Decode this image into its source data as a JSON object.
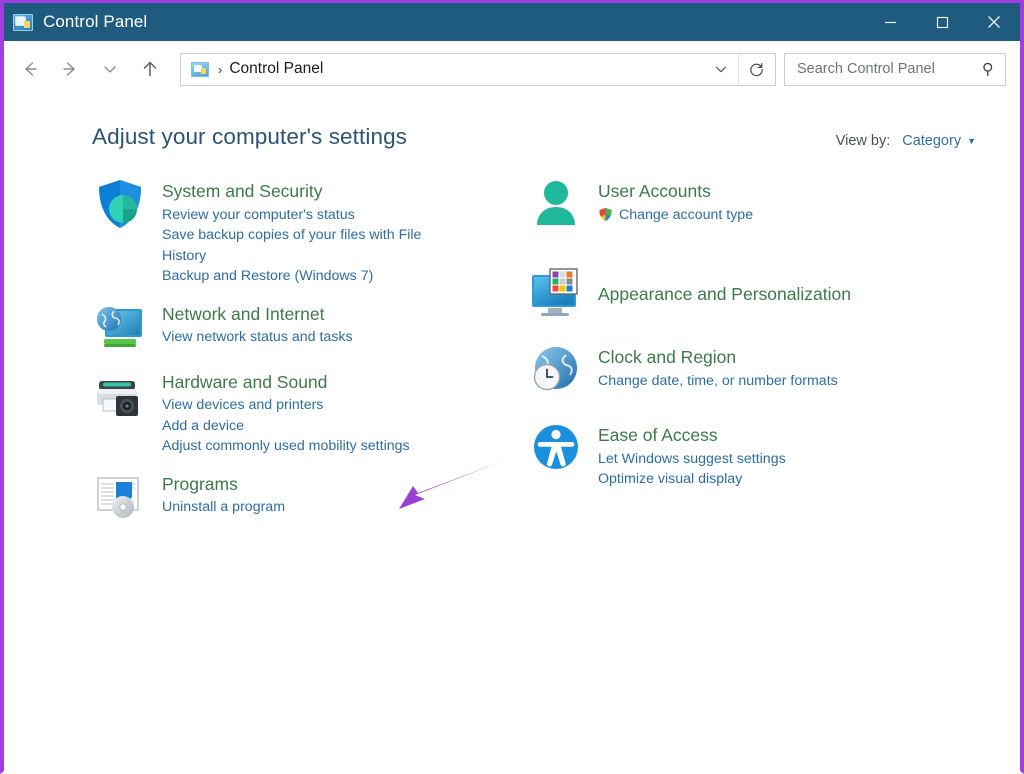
{
  "window": {
    "title": "Control Panel",
    "icon": "control-panel-icon",
    "controls": {
      "minimize": "Minimize",
      "maximize": "Maximize",
      "close": "Close"
    },
    "border_color": "#a23ee0",
    "titlebar_color": "#1f5b7f"
  },
  "navbar": {
    "back": "Back",
    "forward": "Forward",
    "recent": "Recent locations",
    "up": "Up",
    "breadcrumb": {
      "icon": "control-panel-icon",
      "separator": "›",
      "path": "Control Panel"
    },
    "previous_locations": "Previous locations",
    "refresh": "Refresh",
    "search": {
      "placeholder": "Search Control Panel",
      "value": "",
      "icon": "search-icon"
    }
  },
  "content": {
    "page_title": "Adjust your computer's settings",
    "view_by": {
      "label": "View by:",
      "value": "Category",
      "caret": "▼"
    },
    "heading_color": "#3c7a49",
    "link_color": "#2c6ea3",
    "title_color": "#2c5373"
  },
  "categories": {
    "left": [
      {
        "icon": "security-shield-icon",
        "title": "System and Security",
        "links": [
          "Review your computer's status",
          "Save backup copies of your files with File History",
          "Backup and Restore (Windows 7)"
        ]
      },
      {
        "icon": "network-globe-monitor-icon",
        "title": "Network and Internet",
        "links": [
          "View network status and tasks"
        ]
      },
      {
        "icon": "printer-speaker-icon",
        "title": "Hardware and Sound",
        "links": [
          "View devices and printers",
          "Add a device",
          "Adjust commonly used mobility settings"
        ]
      },
      {
        "icon": "programs-disc-icon",
        "title": "Programs",
        "links": [
          "Uninstall a program"
        ]
      }
    ],
    "right": [
      {
        "icon": "user-account-icon",
        "title": "User Accounts",
        "links": [
          "Change account type"
        ],
        "link_shield": true,
        "shield_icon": "uac-shield-icon"
      },
      {
        "icon": "appearance-monitor-icon",
        "title": "Appearance and Personalization",
        "links": []
      },
      {
        "icon": "clock-globe-icon",
        "title": "Clock and Region",
        "links": [
          "Change date, time, or number formats"
        ]
      },
      {
        "icon": "ease-of-access-icon",
        "title": "Ease of Access",
        "links": [
          "Let Windows suggest settings",
          "Optimize visual display"
        ]
      }
    ]
  },
  "annotation": {
    "type": "arrow",
    "color": "#9b3fd4",
    "points_to": "Hardware and Sound"
  }
}
